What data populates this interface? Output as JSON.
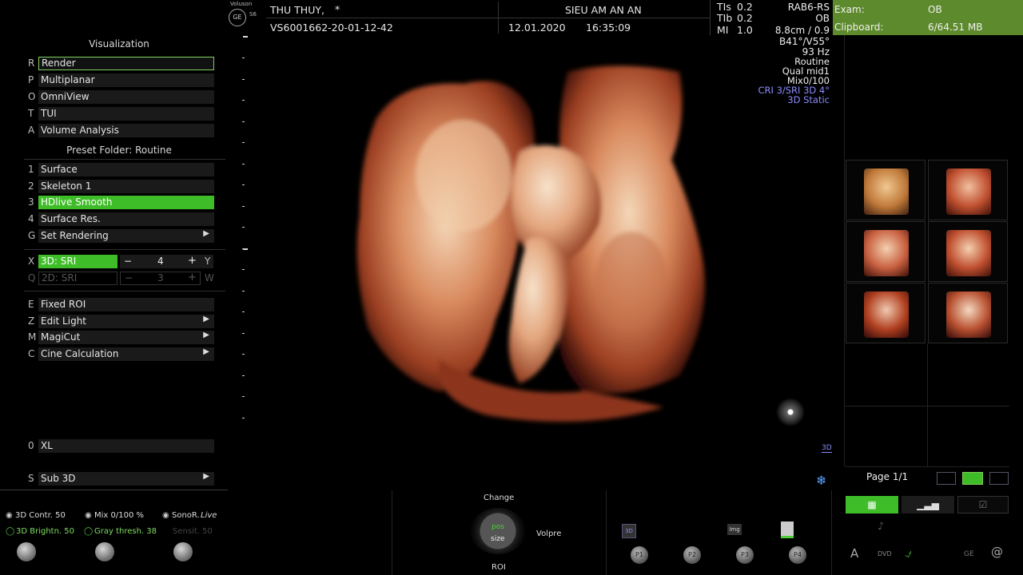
{
  "header": {
    "brand": "Voluson",
    "brand_model": "S6",
    "brand_logo": "GE",
    "patient_name": "THU THUY,",
    "patient_star": "*",
    "patient_id": "VS6001662-20-01-12-42",
    "institution": "SIEU AM AN AN",
    "date": "12.01.2020",
    "time": "16:35:09",
    "tis_label": "TIs",
    "tis_value": "0.2",
    "tib_label": "TIb",
    "tib_value": "0.2",
    "mi_label": "MI",
    "mi_value": "1.0",
    "probe": "RAB6-RS",
    "exam_short": "OB"
  },
  "right_info": {
    "depth": "8.8cm / 0.9",
    "angles": "B41°/V55°",
    "freq": "93 Hz",
    "preset": "Routine",
    "quality": "Qual mid1",
    "mix": "Mix0/100",
    "cri": "CRI 3/SRI 3D 4°",
    "mode": "3D Static",
    "indicator": "3D"
  },
  "exam_panel": {
    "exam_label": "Exam:",
    "exam_value": "OB",
    "clipboard_label": "Clipboard:",
    "clipboard_value": "6/64.51 MB",
    "page": "Page 1/1"
  },
  "left_panel": {
    "visualization_title": "Visualization",
    "viz_items": [
      {
        "key": "R",
        "label": "Render"
      },
      {
        "key": "P",
        "label": "Multiplanar"
      },
      {
        "key": "O",
        "label": "OmniView"
      },
      {
        "key": "T",
        "label": "TUI"
      },
      {
        "key": "A",
        "label": "Volume Analysis"
      }
    ],
    "preset_title": "Preset Folder: Routine",
    "preset_items": [
      {
        "key": "1",
        "label": "Surface"
      },
      {
        "key": "2",
        "label": "Skeleton 1"
      },
      {
        "key": "3",
        "label": "HDlive Smooth"
      },
      {
        "key": "4",
        "label": "Surface Res."
      },
      {
        "key": "G",
        "label": "Set Rendering"
      }
    ],
    "sri": {
      "key": "X",
      "label": "3D: SRI",
      "minus": "−",
      "value": "4",
      "plus": "+",
      "right_key": "Y"
    },
    "sri2": {
      "key": "Q",
      "label": "2D: SRI",
      "minus": "−",
      "value": "3",
      "plus": "+",
      "right_key": "W"
    },
    "tool_items": [
      {
        "key": "E",
        "label": "Fixed ROI"
      },
      {
        "key": "Z",
        "label": "Edit Light"
      },
      {
        "key": "M",
        "label": "MagiCut"
      },
      {
        "key": "C",
        "label": "Cine Calculation"
      }
    ],
    "xl": {
      "key": "0",
      "label": "XL"
    },
    "sub3d": {
      "key": "S",
      "label": "Sub 3D"
    }
  },
  "bottom": {
    "contr": "3D Contr. 50",
    "mix": "Mix 0/100 %",
    "sonor": "SonoR.",
    "sonor_live": "Live",
    "brightn": "3D Brightn. 50",
    "gray": "Gray thresh. 38",
    "sensit": "Sensit. 50",
    "change": "Change",
    "pos": "pos",
    "size": "size",
    "roi": "ROI",
    "volpre": "Volpre",
    "p1": "P1",
    "p2": "P2",
    "p3": "P3",
    "p4": "P4",
    "img_label": "Img",
    "a_label": "A",
    "dvd_label": "DVD",
    "ge_label": "GE",
    "at_label": "@"
  },
  "colors": {
    "accent_green": "#3fbd28",
    "exam_bar": "#5d8a2c",
    "info_blue": "#8b8bff"
  }
}
